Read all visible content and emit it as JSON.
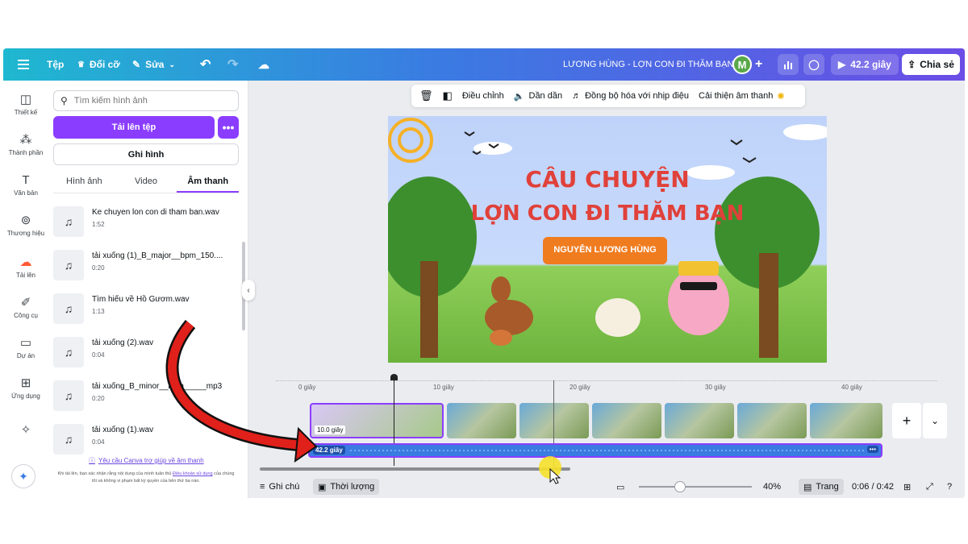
{
  "topbar": {
    "menu_label": "Tệp",
    "resize_label": "Đổi cỡ",
    "edit_label": "Sửa",
    "doc_title": "LƯƠNG HÙNG - LỢN CON ĐI THĂM BẠN",
    "avatar_letter": "M",
    "play_label": "42.2 giây",
    "share_label": "Chia sẻ"
  },
  "rail": [
    {
      "label": "Thiết kế",
      "icon": "design-icon"
    },
    {
      "label": "Thành phần",
      "icon": "elements-icon"
    },
    {
      "label": "Văn bản",
      "icon": "text-icon"
    },
    {
      "label": "Thương hiệu",
      "icon": "brand-icon"
    },
    {
      "label": "Tải lên",
      "icon": "upload-icon"
    },
    {
      "label": "Công cụ",
      "icon": "tools-icon"
    },
    {
      "label": "Dự án",
      "icon": "projects-icon"
    },
    {
      "label": "Ứng dụng",
      "icon": "apps-icon"
    }
  ],
  "panel": {
    "search_placeholder": "Tìm kiếm hình ảnh",
    "upload_label": "Tải lên tệp",
    "more_label": "•••",
    "record_label": "Ghi hình",
    "tabs": [
      "Hình ảnh",
      "Video",
      "Âm thanh"
    ],
    "active_tab": "Âm thanh",
    "files": [
      {
        "name": "Ke chuyen lon con di tham ban.wav",
        "duration": "1:52"
      },
      {
        "name": "tải xuống (1)_B_major__bpm_150....",
        "duration": "0:20"
      },
      {
        "name": "Tìm hiểu về Hồ Gươm.wav",
        "duration": "1:13"
      },
      {
        "name": "tải xuống (2).wav",
        "duration": "0:04"
      },
      {
        "name": "tải xuống_B_minor__bpm_____mp3",
        "duration": "0:20"
      },
      {
        "name": "tải xuống (1).wav",
        "duration": "0:04"
      }
    ],
    "help_link": "Yêu cầu Canva trợ giúp về âm thanh",
    "disclaimer_prefix": "Khi tải lên, bạn xác nhận rằng nội dung của mình tuân thủ",
    "disclaimer_link": "Điều khoản sử dụng",
    "disclaimer_suffix": "của chúng tôi và không vi phạm bất kỳ quyền của bên thứ ba nào."
  },
  "context_toolbar": {
    "adjust": "Điều chỉnh",
    "fade": "Dần dần",
    "sync": "Đồng bộ hóa với nhịp điệu",
    "enhance": "Cải thiện âm thanh"
  },
  "canvas": {
    "title_line1": "CÂU CHUYỆN",
    "title_line2": "LỢN CON ĐI THĂM BẠN",
    "author": "NGUYỄN LƯƠNG HÙNG"
  },
  "timeline": {
    "ticks": [
      "0 giây",
      "10 giây",
      "20 giây",
      "30 giây",
      "40 giây"
    ],
    "first_clip_duration": "10.0 giây",
    "audio_duration": "42.2 giây"
  },
  "bottombar": {
    "notes": "Ghi chú",
    "duration": "Thời lượng",
    "zoom": "40%",
    "zoom_level": 0.4,
    "pages": "Trang",
    "time": "0:06 / 0:42"
  }
}
